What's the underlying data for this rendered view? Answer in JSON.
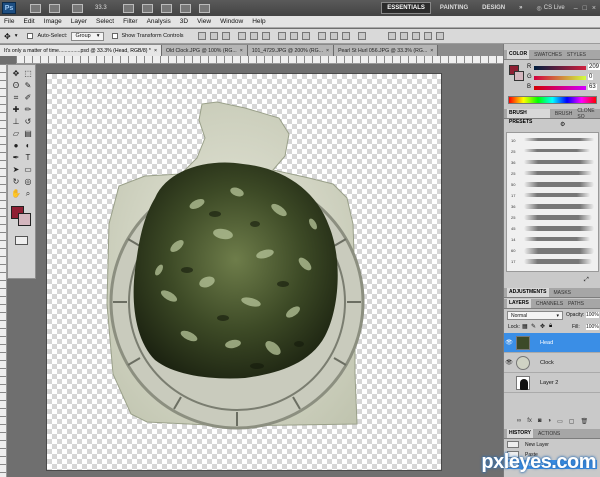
{
  "app": {
    "logo": "Ps",
    "zoom": "33.3",
    "workspaces": [
      "ESSENTIALS",
      "PAINTING",
      "DESIGN",
      "»"
    ],
    "active_workspace": "ESSENTIALS",
    "cslive": "CS Live"
  },
  "menu": [
    "File",
    "Edit",
    "Image",
    "Layer",
    "Select",
    "Filter",
    "Analysis",
    "3D",
    "View",
    "Window",
    "Help"
  ],
  "options": {
    "auto_select_label": "Auto-Select:",
    "auto_select_value": "Group",
    "show_transform_label": "Show Transform Controls"
  },
  "doc_tabs": [
    "It's only a matter of time...............psd @ 33.3% (Head, RGB/8) *",
    "Old Clock.JPG @ 100% (RG...",
    "101_4729.JPG @ 200% (RG...",
    "Pearl St Hurl 056.JPG @ 33.3% (RG..."
  ],
  "color_panel": {
    "tabs": [
      "COLOR",
      "SWATCHES",
      "STYLES"
    ],
    "r": "209",
    "g": "0",
    "b": "63",
    "fg_color": "#8f1f33",
    "bg_color": "#d4b6be"
  },
  "brush_panel": {
    "tabs": [
      "BRUSH PRESETS",
      "BRUSH",
      "CLONE SO"
    ],
    "sizes": [
      "10",
      "25",
      "36",
      "25",
      "50",
      "17",
      "36",
      "25",
      "45",
      "14",
      "60",
      "17"
    ]
  },
  "adjust_panel": {
    "tabs": [
      "ADJUSTMENTS",
      "MASKS"
    ]
  },
  "layers_panel": {
    "tabs": [
      "LAYERS",
      "CHANNELS",
      "PATHS"
    ],
    "blend_mode": "Normal",
    "opacity_label": "Opacity:",
    "opacity": "100%",
    "lock_label": "Lock:",
    "fill_label": "Fill:",
    "fill": "100%",
    "layers": [
      {
        "name": "Head",
        "selected": true
      },
      {
        "name": "Clock",
        "selected": false
      },
      {
        "name": "Layer 2",
        "selected": false
      }
    ]
  },
  "history_panel": {
    "tabs": [
      "HISTORY",
      "ACTIONS"
    ],
    "items": [
      "New Layer",
      "Paste",
      "Deselect"
    ]
  },
  "watermark": "pxleyes.com"
}
